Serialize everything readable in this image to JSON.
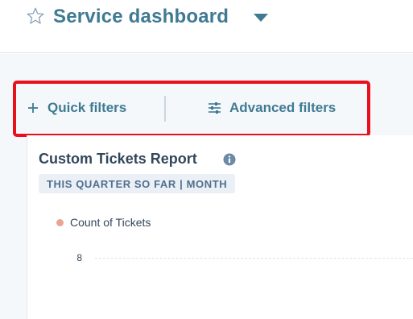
{
  "header": {
    "title": "Service dashboard",
    "favorite_icon": "star-outline-icon",
    "dropdown_icon": "caret-down-icon"
  },
  "filters": {
    "quick_label": "Quick filters",
    "quick_icon": "plus-icon",
    "advanced_label": "Advanced filters",
    "advanced_icon": "sliders-icon",
    "highlight_color": "#e8101d"
  },
  "report": {
    "title": "Custom Tickets Report",
    "info_icon": "info-icon",
    "date_range": "THIS QUARTER SO FAR | MONTH"
  },
  "chart_data": {
    "type": "bar",
    "series": [
      {
        "name": "Count of Tickets",
        "color": "#eaa592",
        "values": []
      }
    ],
    "y_ticks": [
      "8"
    ],
    "grid": true,
    "legend_position": "top-left"
  },
  "colors": {
    "accent": "#3f7a93",
    "text_primary": "#33475b",
    "badge_bg": "#eaf0f6",
    "badge_text": "#516f90",
    "page_bg": "#f5f8fa"
  }
}
